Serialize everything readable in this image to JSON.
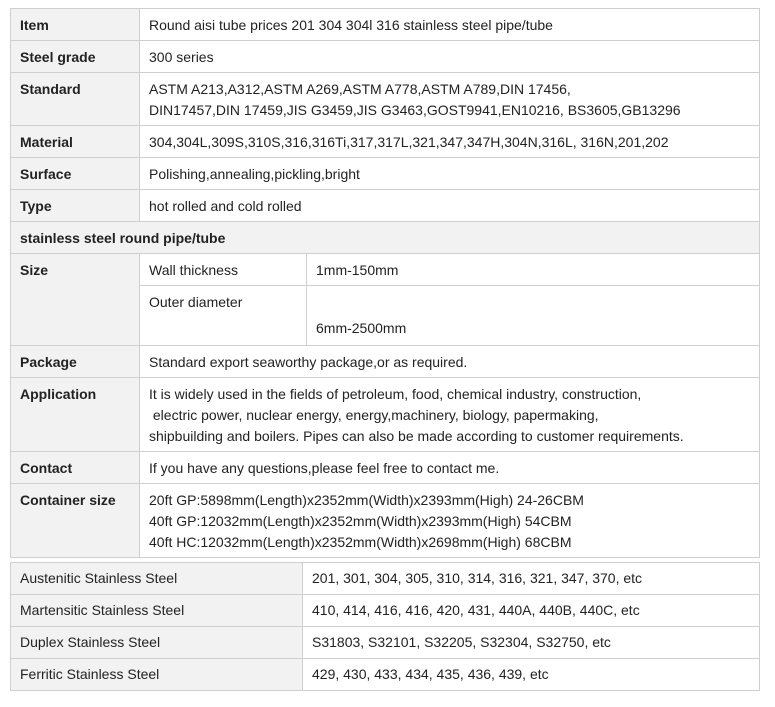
{
  "spec": {
    "item_label": "Item",
    "item_value": "Round aisi tube prices 201 304 304l 316 stainless steel pipe/tube",
    "grade_label": "Steel grade",
    "grade_value": "300 series",
    "standard_label": "Standard",
    "standard_line1": "ASTM A213,A312,ASTM A269,ASTM A778,ASTM A789,DIN 17456,",
    "standard_line2": "DIN17457,DIN 17459,JIS G3459,JIS G3463,GOST9941,EN10216, BS3605,GB13296",
    "material_label": "Material",
    "material_value": "304,304L,309S,310S,316,316Ti,317,317L,321,347,347H,304N,316L, 316N,201,202",
    "surface_label": "Surface",
    "surface_value": "Polishing,annealing,pickling,bright",
    "type_label": "Type",
    "type_value": "hot rolled and cold rolled",
    "section_title": "stainless steel round pipe/tube",
    "size_label": "Size",
    "wall_label": "Wall thickness",
    "wall_value": "1mm-150mm",
    "outer_label": "Outer diameter",
    "outer_value": "6mm-2500mm",
    "package_label": "Package",
    "package_value": "Standard export seaworthy package,or as required.",
    "application_label": "Application",
    "application_line1": "It is widely used in the fields of petroleum, food, chemical industry, construction,",
    "application_line2": " electric power, nuclear energy, energy,machinery, biology, papermaking,",
    "application_line3": "shipbuilding and boilers. Pipes can also be made according to customer requirements.",
    "contact_label": "Contact",
    "contact_value": "If you have any questions,please feel free to contact me.",
    "container_label": "Container size",
    "container_line1": "20ft GP:5898mm(Length)x2352mm(Width)x2393mm(High) 24-26CBM",
    "container_line2": "40ft GP:12032mm(Length)x2352mm(Width)x2393mm(High) 54CBM",
    "container_line3": "40ft HC:12032mm(Length)x2352mm(Width)x2698mm(High) 68CBM"
  },
  "grades": [
    {
      "family": "Austenitic Stainless Steel",
      "numbers": "201, 301, 304, 305, 310, 314, 316, 321, 347, 370, etc"
    },
    {
      "family": "Martensitic Stainless Steel",
      "numbers": "410, 414, 416, 416, 420, 431, 440A, 440B, 440C, etc"
    },
    {
      "family": "Duplex Stainless Steel",
      "numbers": "S31803, S32101, S32205, S32304, S32750, etc"
    },
    {
      "family": "Ferritic Stainless Steel",
      "numbers": "429, 430, 433, 434, 435, 436, 439, etc"
    }
  ]
}
